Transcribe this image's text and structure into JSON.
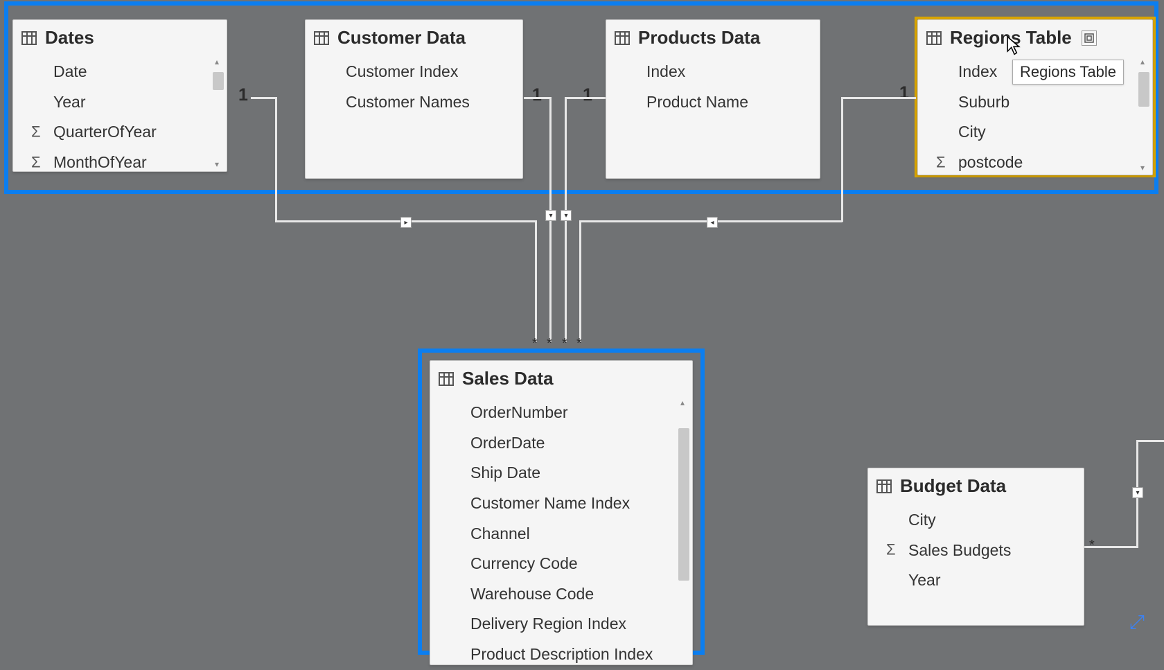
{
  "tables": {
    "dates": {
      "title": "Dates",
      "fields": [
        {
          "label": "Date",
          "sigma": false
        },
        {
          "label": "Year",
          "sigma": false
        },
        {
          "label": "QuarterOfYear",
          "sigma": true
        },
        {
          "label": "MonthOfYear",
          "sigma": true
        }
      ]
    },
    "customer": {
      "title": "Customer Data",
      "fields": [
        {
          "label": "Customer Index",
          "sigma": false
        },
        {
          "label": "Customer Names",
          "sigma": false
        }
      ]
    },
    "products": {
      "title": "Products Data",
      "fields": [
        {
          "label": "Index",
          "sigma": false
        },
        {
          "label": "Product Name",
          "sigma": false
        }
      ]
    },
    "regions": {
      "title": "Regions Table",
      "fields": [
        {
          "label": "Index",
          "sigma": false
        },
        {
          "label": "Suburb",
          "sigma": false
        },
        {
          "label": "City",
          "sigma": false
        },
        {
          "label": "postcode",
          "sigma": true
        }
      ]
    },
    "sales": {
      "title": "Sales Data",
      "fields": [
        {
          "label": "OrderNumber",
          "sigma": false
        },
        {
          "label": "OrderDate",
          "sigma": false
        },
        {
          "label": "Ship Date",
          "sigma": false
        },
        {
          "label": "Customer Name Index",
          "sigma": false
        },
        {
          "label": "Channel",
          "sigma": false
        },
        {
          "label": "Currency Code",
          "sigma": false
        },
        {
          "label": "Warehouse Code",
          "sigma": false
        },
        {
          "label": "Delivery Region Index",
          "sigma": false
        },
        {
          "label": "Product Description Index",
          "sigma": false
        }
      ]
    },
    "budget": {
      "title": "Budget Data",
      "fields": [
        {
          "label": "City",
          "sigma": false
        },
        {
          "label": "Sales Budgets",
          "sigma": true
        },
        {
          "label": "Year",
          "sigma": false
        }
      ]
    }
  },
  "tooltip": "Regions Table",
  "cardinality": {
    "one": "1",
    "many": "*"
  }
}
